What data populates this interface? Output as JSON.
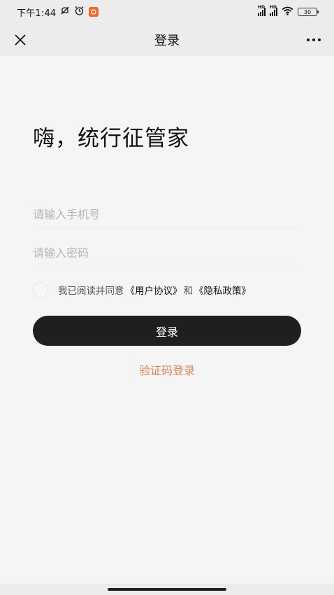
{
  "status_bar": {
    "time": "下午1:44",
    "battery": "30",
    "icons": [
      "mute-icon",
      "alarm-icon",
      "app-badge",
      "signal-icon",
      "signal-icon",
      "wifi-icon",
      "battery-icon"
    ]
  },
  "nav": {
    "title": "登录",
    "left_icon": "close-icon",
    "right_icon": "more-icon"
  },
  "greeting": "嗨，统行征管家",
  "form": {
    "phone_placeholder": "请输入手机号",
    "password_placeholder": "请输入密码"
  },
  "agreement": {
    "prefix": "我已阅读并同意",
    "user_agreement": "《用户协议》",
    "conjunction": "和",
    "privacy_policy": "《隐私政策》",
    "checked": false
  },
  "login_button_label": "登录",
  "code_login_label": "验证码登录",
  "colors": {
    "background": "#f5f5f5",
    "primary_button": "#1f1f1f",
    "link_accent": "#e0865a"
  }
}
